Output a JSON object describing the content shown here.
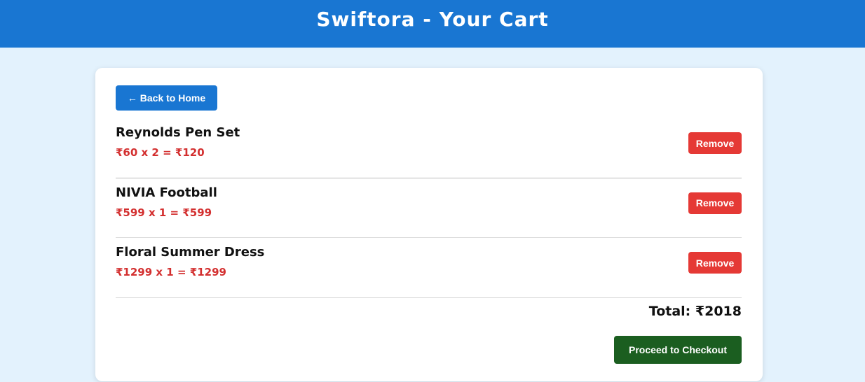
{
  "header": {
    "title": "Swiftora - Your Cart"
  },
  "nav": {
    "back_label": "← Back to Home"
  },
  "cart": {
    "items": [
      {
        "name": "Reynolds Pen Set",
        "price_line": "₹60 x 2 = ₹120",
        "remove_label": "Remove"
      },
      {
        "name": "NIVIA Football",
        "price_line": "₹599 x 1 = ₹599",
        "remove_label": "Remove"
      },
      {
        "name": "Floral Summer Dress",
        "price_line": "₹1299 x 1 = ₹1299",
        "remove_label": "Remove"
      }
    ],
    "total": "Total: ₹2018",
    "checkout_label": "Proceed to Checkout"
  },
  "colors": {
    "header_bg": "#1976d2",
    "page_bg": "#e3f2fd",
    "back_button": "#1976d2",
    "remove_button": "#e53935",
    "price_text": "#d32f2f",
    "checkout_button": "#1b5e20"
  }
}
